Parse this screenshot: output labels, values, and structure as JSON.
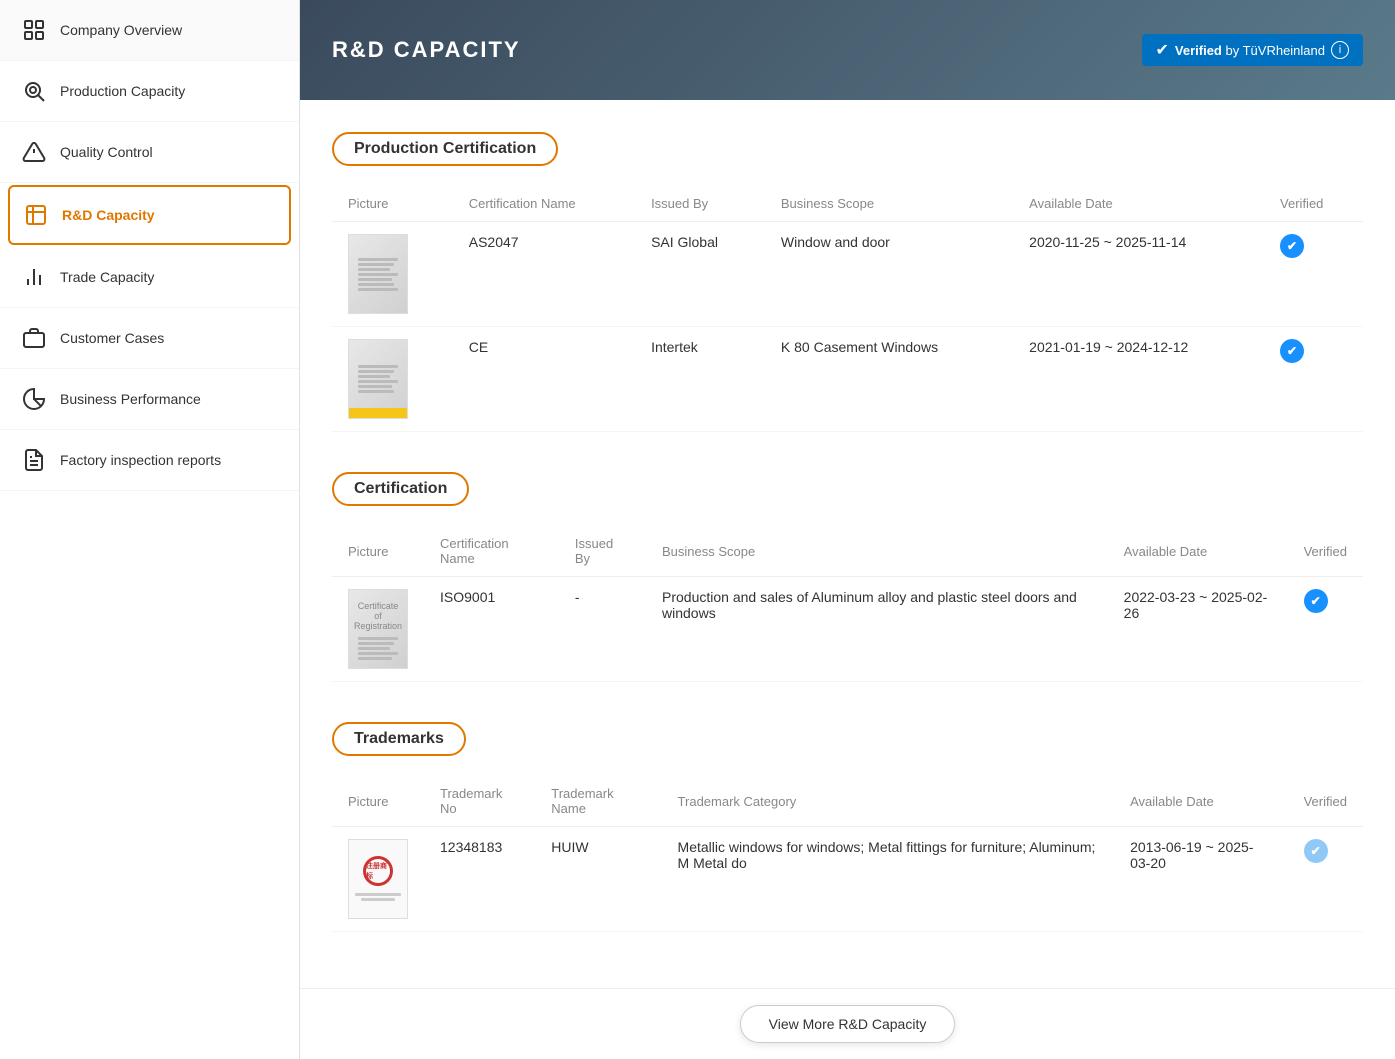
{
  "sidebar": {
    "items": [
      {
        "id": "company-overview",
        "label": "Company Overview",
        "icon": "🏢",
        "active": false
      },
      {
        "id": "production-capacity",
        "label": "Production Capacity",
        "icon": "⚙️",
        "active": false
      },
      {
        "id": "quality-control",
        "label": "Quality Control",
        "icon": "⚠️",
        "active": false
      },
      {
        "id": "rd-capacity",
        "label": "R&D Capacity",
        "icon": "🔬",
        "active": true
      },
      {
        "id": "trade-capacity",
        "label": "Trade Capacity",
        "icon": "📊",
        "active": false
      },
      {
        "id": "customer-cases",
        "label": "Customer Cases",
        "icon": "💼",
        "active": false
      },
      {
        "id": "business-performance",
        "label": "Business Performance",
        "icon": "📈",
        "active": false
      },
      {
        "id": "factory-inspection",
        "label": "Factory inspection reports",
        "icon": "📋",
        "active": false
      }
    ]
  },
  "header": {
    "title": "R&D CAPACITY",
    "verified_label": "Verified",
    "verified_by": "by TüVRheinland",
    "info_icon": "ℹ"
  },
  "production_certification": {
    "section_title": "Production Certification",
    "columns": [
      "Picture",
      "Certification Name",
      "Issued By",
      "Business Scope",
      "Available Date",
      "Verified"
    ],
    "rows": [
      {
        "certification_name": "AS2047",
        "issued_by": "SAI Global",
        "business_scope": "Window and door",
        "available_date": "2020-11-25 ~ 2025-11-14",
        "verified": true
      },
      {
        "certification_name": "CE",
        "issued_by": "Intertek",
        "business_scope": "K 80 Casement Windows",
        "available_date": "2021-01-19 ~ 2024-12-12",
        "verified": true
      }
    ]
  },
  "certification": {
    "section_title": "Certification",
    "columns": [
      "Picture",
      "Certification Name",
      "Issued By",
      "Business Scope",
      "Available Date",
      "Verified"
    ],
    "rows": [
      {
        "certification_name": "ISO9001",
        "issued_by": "-",
        "business_scope": "Production and sales of Aluminum alloy and plastic steel doors and windows",
        "available_date": "2022-03-23 ~ 2025-02-26",
        "verified": true
      }
    ]
  },
  "trademarks": {
    "section_title": "Trademarks",
    "columns": [
      "Picture",
      "Trademark No",
      "Trademark Name",
      "Trademark Category",
      "Available Date",
      "Verified"
    ],
    "rows": [
      {
        "trademark_no": "12348183",
        "trademark_name": "HUIW",
        "trademark_category": "Metallic windows for windows; Metal fittings for furniture; Aluminum; M Metal do",
        "available_date": "2013-06-19 ~ 2025-03-20",
        "verified": false
      }
    ]
  },
  "view_more_button": "View More R&D Capacity"
}
